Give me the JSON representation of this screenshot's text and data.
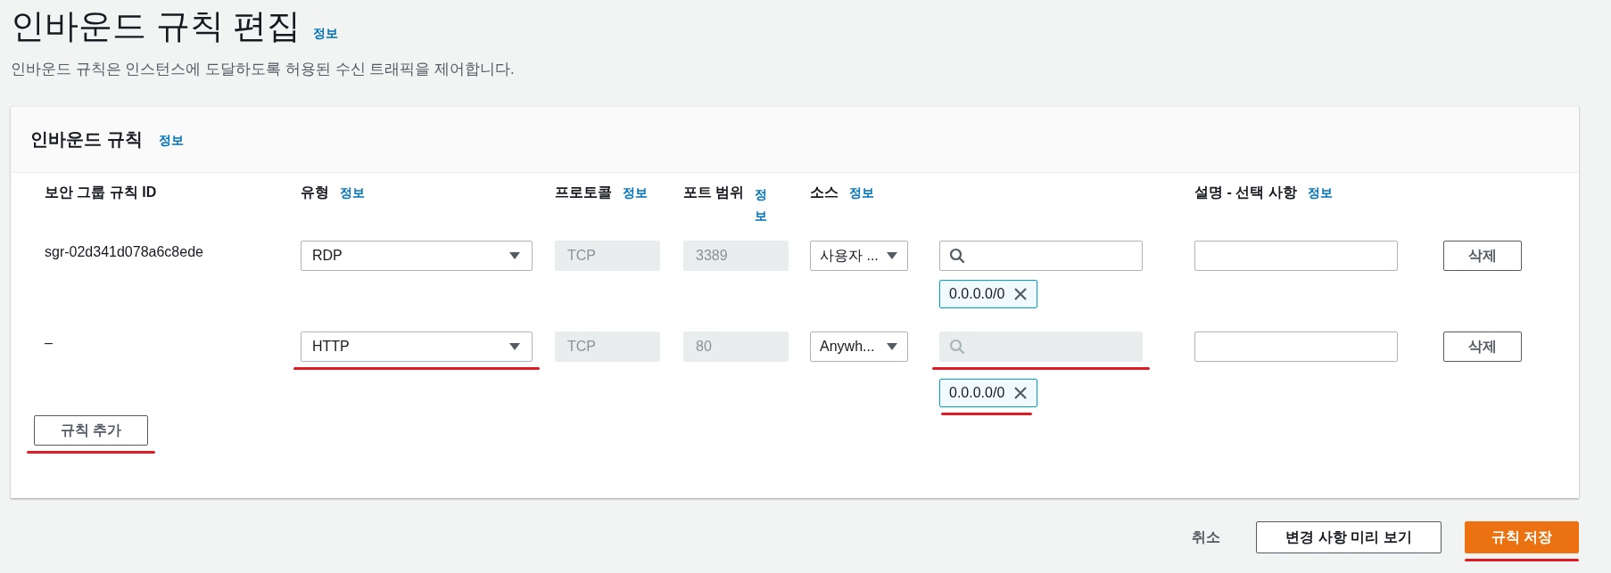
{
  "page": {
    "title": "인바운드 규칙 편집",
    "title_info": "정보",
    "description": "인바운드 규칙은 인스턴스에 도달하도록 허용된 수신 트래픽을 제어합니다."
  },
  "panel": {
    "title": "인바운드 규칙",
    "title_info": "정보",
    "columns": [
      {
        "label": "보안 그룹 규칙 ID"
      },
      {
        "label": "유형",
        "info": "정보"
      },
      {
        "label": "프로토콜",
        "info": "정보"
      },
      {
        "label": "포트 범위",
        "info": "정보"
      },
      {
        "label": "소스",
        "info": "정보"
      },
      {
        "label": "설명 - 선택 사항",
        "info": "정보"
      }
    ],
    "rows": [
      {
        "rule_id": "sgr-02d341d078a6c8ede",
        "type": {
          "value": "RDP"
        },
        "protocol": "TCP",
        "port_range": "3389",
        "source_type": "사용자 ...",
        "source_search": {
          "disabled": false
        },
        "cidrs": [
          {
            "label": "0.0.0.0/0"
          }
        ],
        "delete": "삭제"
      },
      {
        "rule_id": "–",
        "type": {
          "value": "HTTP",
          "underlined": true
        },
        "protocol": "TCP",
        "port_range": "80",
        "source_type": "Anywh...",
        "source_search": {
          "disabled": true,
          "underlined": true
        },
        "cidrs": [
          {
            "label": "0.0.0.0/0",
            "underlined": true
          }
        ],
        "delete": "삭제"
      }
    ],
    "add_rule": {
      "label": "규칙 추가",
      "underlined": true
    }
  },
  "footer": {
    "cancel": "취소",
    "preview": {
      "label": "변경 사항 미리 보기"
    },
    "save": {
      "label": "규칙 저장",
      "underlined": true
    }
  }
}
